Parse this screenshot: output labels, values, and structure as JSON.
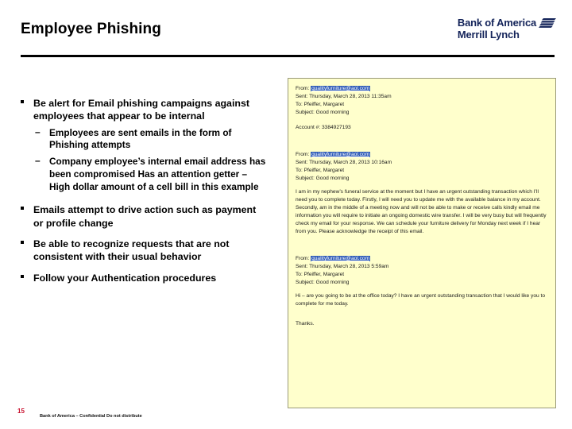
{
  "slide": {
    "title": "Employee Phishing",
    "page_number": "15",
    "footer_note": "Bank of America – Confidential  Do not distribute"
  },
  "brand": {
    "line1": "Bank of America",
    "line2": "Merrill Lynch",
    "flag_icon": "bofa-flag-icon",
    "color": "#132359"
  },
  "bullets": {
    "b1": "Be alert for Email phishing campaigns against employees that appear to be internal",
    "b1_sub1": "Employees are sent emails in the form of Phishing attempts",
    "b1_sub2": "Company  employee’s internal email address has been compromised Has an attention getter – High dollar amount of a cell bill in this example",
    "b2": "Emails attempt to drive action such as payment or profile change",
    "b3": "Be able to recognize requests that are not consistent with their usual behavior",
    "b4": "Follow your Authentication procedures",
    "marker_l1": "square-bullet-marker",
    "marker_l2": "–"
  },
  "emails": {
    "email1": {
      "from_label": "From:",
      "from_address": "qualityfurniture@aol.com",
      "sent": "Sent: Thursday, March 28, 2013  11:35am",
      "to": "To: Pfeiffer, Margaret",
      "subject": "Subject: Good morning",
      "account": "Account #: 3384927193"
    },
    "email2": {
      "from_label": "From:",
      "from_address": "qualityfurniture@aol.com",
      "sent": "Sent: Thursday, March 28, 2013  10:16am",
      "to": "To: Pfeiffer, Margaret",
      "subject": "Subject: Good morning",
      "body": "I am in my nephew’s funeral service at the moment but I have an urgent outstanding transaction which I’ll need you to complete today.  Firstly, I will need you to update me with the available balance in my account.  Secondly, am in the middle of a meeting now and will not be able to make or receive calls  kindly email me information you will require to initiate an ongoing domestic wire transfer.  I will be very busy but will frequently check my email for your response.   We can schedule your furniture delivery for Monday next week if I hear from you. Please acknowledge the receipt of this email."
    },
    "email3": {
      "from_label": "From:",
      "from_address": "qualityfurniture@aol.com",
      "sent": "Sent: Thursday, March 28, 2013  5:59am",
      "to": "To: Pfeiffer, Margaret",
      "subject": "Subject: Good morning",
      "body": "Hi – are you going to be at the office today?  I have an urgent  outstanding transaction that I would like you to complete for me today.",
      "signoff": "Thanks."
    }
  },
  "colors": {
    "panel_background": "#ffffcc",
    "panel_border": "#9a9a7a",
    "rule": "#000000",
    "link_highlight": "#2f5bb7"
  }
}
